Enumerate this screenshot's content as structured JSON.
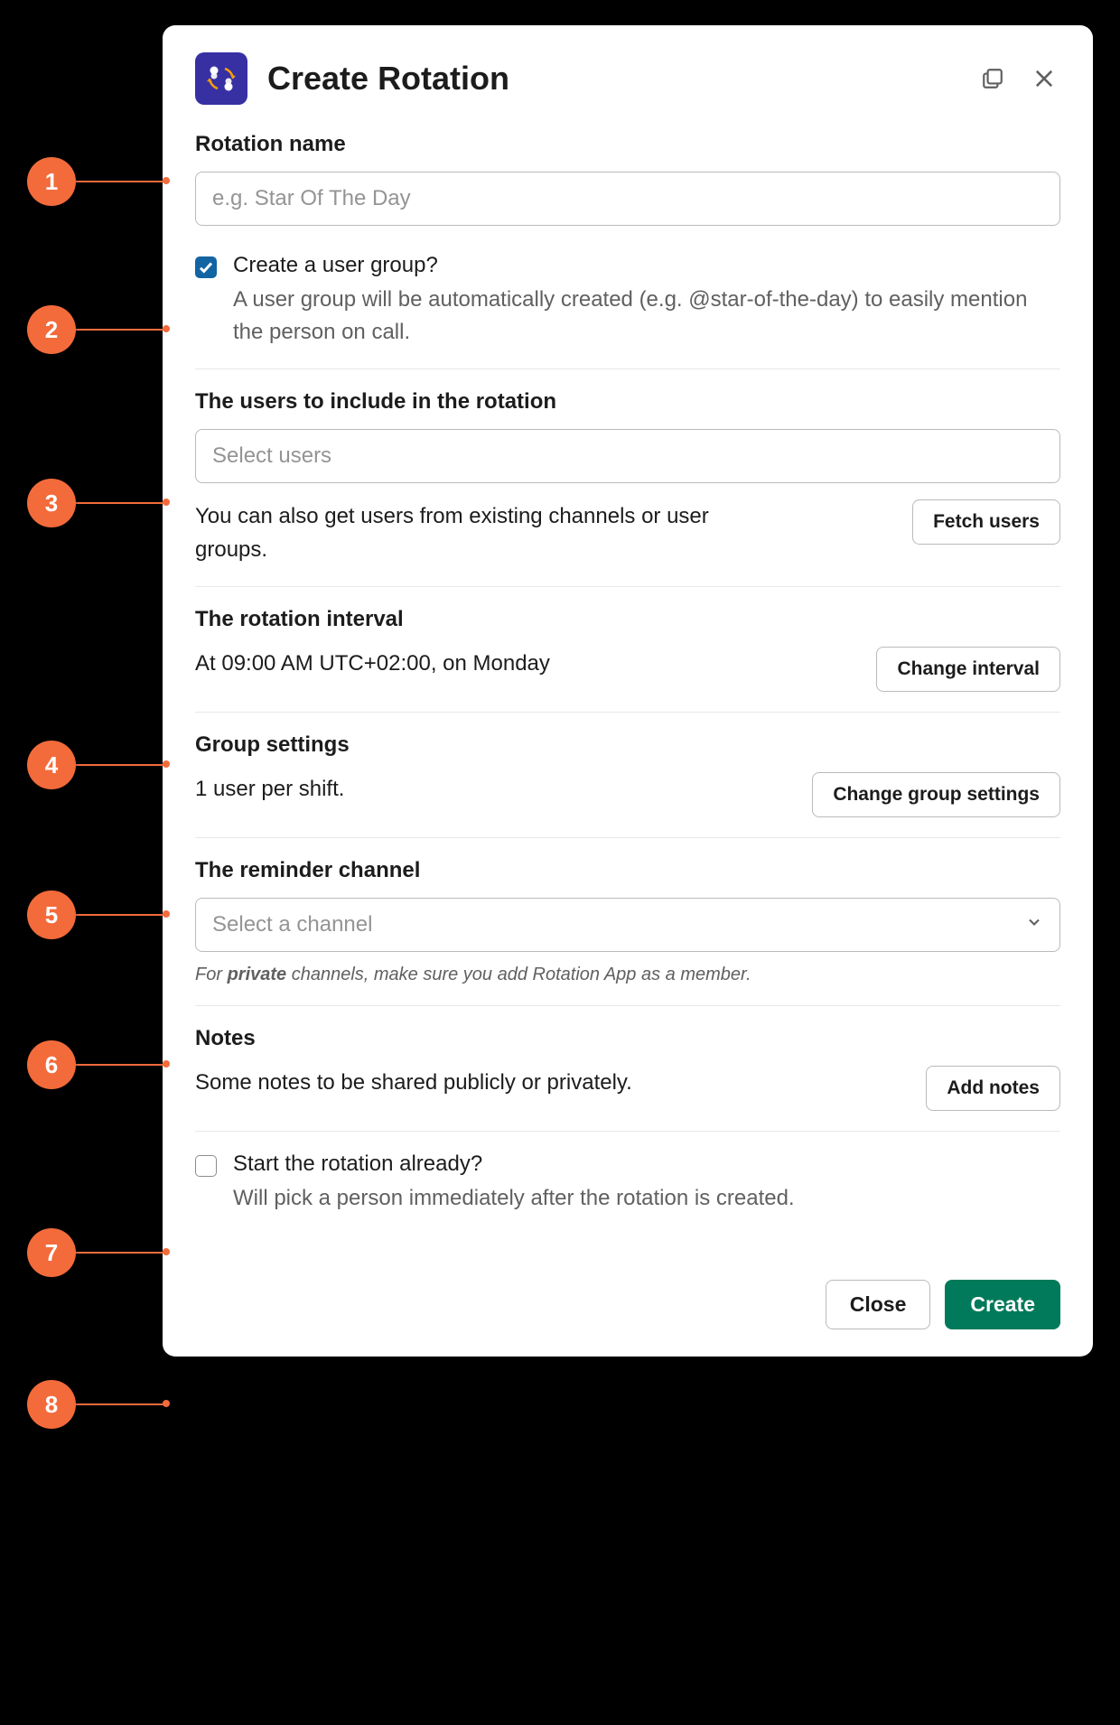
{
  "modal": {
    "title": "Create Rotation",
    "icon_name": "rotation-app-icon"
  },
  "section_name": {
    "label": "Rotation name",
    "placeholder": "e.g. Star Of The Day",
    "value": ""
  },
  "section_usergroup": {
    "checked": true,
    "label": "Create a user group?",
    "desc": "A user group will be automatically created (e.g. @star-of-the-day) to easily mention the person on call."
  },
  "section_users": {
    "label": "The users to include in the rotation",
    "placeholder": "Select users",
    "helper": "You can also get users from existing channels or user groups.",
    "button": "Fetch users"
  },
  "section_interval": {
    "label": "The rotation interval",
    "value": "At 09:00 AM UTC+02:00, on Monday",
    "button": "Change interval"
  },
  "section_group": {
    "label": "Group settings",
    "value": "1 user per shift.",
    "button": "Change group settings"
  },
  "section_channel": {
    "label": "The reminder channel",
    "placeholder": "Select a channel",
    "hint_prefix": "For ",
    "hint_bold": "private",
    "hint_suffix": " channels, make sure you add Rotation App as a member."
  },
  "section_notes": {
    "label": "Notes",
    "value": "Some notes to be shared publicly or privately.",
    "button": "Add notes"
  },
  "section_start": {
    "checked": false,
    "label": "Start the rotation already?",
    "desc": "Will pick a person immediately after the rotation is created."
  },
  "footer": {
    "close": "Close",
    "create": "Create"
  },
  "annotations": [
    "1",
    "2",
    "3",
    "4",
    "5",
    "6",
    "7",
    "8"
  ]
}
